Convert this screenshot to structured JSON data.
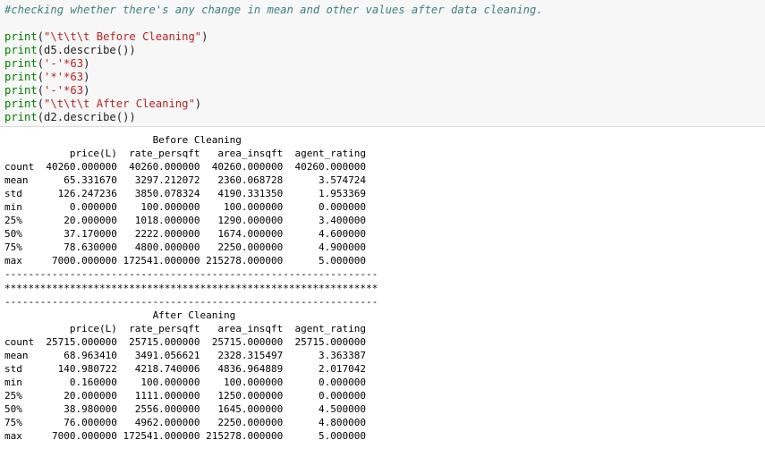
{
  "code_cell": {
    "comment": "#checking whether there's any change in mean and other values after data cleaning.",
    "lines": [
      {
        "fn": "print",
        "arg": "\"\\t\\t\\t Before Cleaning\"",
        "arg_type": "string"
      },
      {
        "fn": "print",
        "arg": "d5.describe()",
        "arg_type": "expr"
      },
      {
        "fn": "print",
        "arg": "'-'*63",
        "arg_type": "mult"
      },
      {
        "fn": "print",
        "arg": "'*'*63",
        "arg_type": "mult"
      },
      {
        "fn": "print",
        "arg": "'-'*63",
        "arg_type": "mult"
      },
      {
        "fn": "print",
        "arg": "\"\\t\\t\\t After Cleaning\"",
        "arg_type": "string"
      },
      {
        "fn": "print",
        "arg": "d2.describe()",
        "arg_type": "expr"
      }
    ]
  },
  "output": {
    "before_title": "                         Before Cleaning",
    "before_header": "           price(L)  rate_persqft   area_insqft  agent_rating",
    "before_rows": [
      "count  40260.000000  40260.000000  40260.000000  40260.000000",
      "mean      65.331670   3297.212072   2360.068728      3.574724",
      "std      126.247236   3850.078324   4190.331350      1.953369",
      "min        0.000000    100.000000    100.000000      0.000000",
      "25%       20.000000   1018.000000   1290.000000      3.400000",
      "50%       37.170000   2222.000000   1674.000000      4.600000",
      "75%       78.630000   4800.000000   2250.000000      4.900000",
      "max     7000.000000 172541.000000 215278.000000      5.000000"
    ],
    "sep_dash": "---------------------------------------------------------------",
    "sep_star": "***************************************************************",
    "after_title": "                         After Cleaning",
    "after_header": "           price(L)  rate_persqft   area_insqft  agent_rating",
    "after_rows": [
      "count  25715.000000  25715.000000  25715.000000  25715.000000",
      "mean      68.963410   3491.056621   2328.315497      3.363387",
      "std      140.980722   4218.740006   4836.964889      2.017042",
      "min        0.160000    100.000000    100.000000      0.000000",
      "25%       20.000000   1111.000000   1250.000000      0.000000",
      "50%       38.980000   2556.000000   1645.000000      4.500000",
      "75%       76.000000   4962.000000   2250.000000      4.800000",
      "max     7000.000000 172541.000000 215278.000000      5.000000"
    ]
  }
}
